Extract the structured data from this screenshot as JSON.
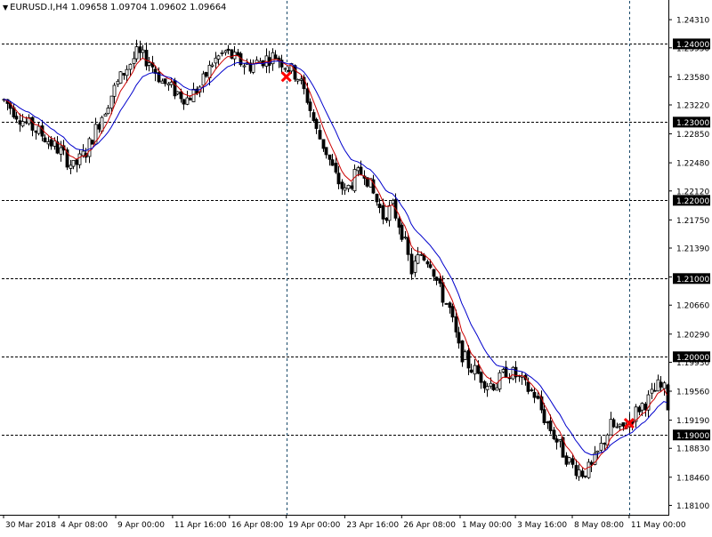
{
  "symbol_header": {
    "arrow_icon": "triangle-down-icon",
    "text": "EURUSD.I,H4  1.09658 1.09704 1.09602 1.09664"
  },
  "chart_data": {
    "type": "candlestick",
    "symbol": "EURUSD.I",
    "timeframe": "H4",
    "ylim": [
      1.1798,
      1.2455
    ],
    "y_ticks": [
      "1.24310",
      "1.23950",
      "1.23580",
      "1.23220",
      "1.22850",
      "1.22480",
      "1.22120",
      "1.21750",
      "1.21390",
      "1.21020",
      "1.20660",
      "1.20290",
      "1.19930",
      "1.19560",
      "1.19190",
      "1.18830",
      "1.18460",
      "1.18100"
    ],
    "x_ticks": [
      "30 Mar 2018",
      "4 Apr 08:00",
      "9 Apr 00:00",
      "11 Apr 16:00",
      "16 Apr 08:00",
      "19 Apr 00:00",
      "23 Apr 16:00",
      "26 Apr 08:00",
      "1 May 00:00",
      "3 May 16:00",
      "8 May 08:00",
      "11 May 00:00"
    ],
    "horizontal_levels": [
      "1.24000",
      "1.23000",
      "1.22000",
      "1.21000",
      "1.20000",
      "1.19000"
    ],
    "vertical_markers": [
      "19 Apr 00:00",
      "11 May 00:00"
    ],
    "signals": [
      {
        "type": "cross",
        "time": "19 Apr 00:00",
        "price": 1.2358
      },
      {
        "type": "cross",
        "time": "11 May 00:00",
        "price": 1.1915
      }
    ],
    "moving_averages": [
      {
        "color": "#cc0000",
        "role": "fast"
      },
      {
        "color": "#0000cc",
        "role": "slow"
      }
    ],
    "close_path": [
      [
        0,
        1.2328
      ],
      [
        6,
        1.2302
      ],
      [
        12,
        1.2284
      ],
      [
        18,
        1.2262
      ],
      [
        22,
        1.2242
      ],
      [
        26,
        1.2262
      ],
      [
        30,
        1.23
      ],
      [
        34,
        1.2335
      ],
      [
        38,
        1.2364
      ],
      [
        42,
        1.2387
      ],
      [
        46,
        1.2378
      ],
      [
        50,
        1.2352
      ],
      [
        54,
        1.234
      ],
      [
        58,
        1.233
      ],
      [
        62,
        1.2345
      ],
      [
        66,
        1.2376
      ],
      [
        70,
        1.239
      ],
      [
        74,
        1.2378
      ],
      [
        78,
        1.2372
      ],
      [
        82,
        1.238
      ],
      [
        86,
        1.2385
      ],
      [
        90,
        1.237
      ],
      [
        93,
        1.2358
      ],
      [
        96,
        1.233
      ],
      [
        99,
        1.2288
      ],
      [
        102,
        1.2262
      ],
      [
        105,
        1.223
      ],
      [
        108,
        1.221
      ],
      [
        111,
        1.223
      ],
      [
        114,
        1.2238
      ],
      [
        117,
        1.2208
      ],
      [
        120,
        1.218
      ],
      [
        123,
        1.2192
      ],
      [
        126,
        1.216
      ],
      [
        129,
        1.211
      ],
      [
        132,
        1.2132
      ],
      [
        135,
        1.2122
      ],
      [
        138,
        1.2085
      ],
      [
        141,
        1.206
      ],
      [
        144,
        1.201
      ],
      [
        147,
        1.199
      ],
      [
        150,
        1.1978
      ],
      [
        153,
        1.1966
      ],
      [
        156,
        1.1965
      ],
      [
        159,
        1.1982
      ],
      [
        162,
        1.1976
      ],
      [
        165,
        1.1962
      ],
      [
        168,
        1.1952
      ],
      [
        171,
        1.1922
      ],
      [
        174,
        1.19
      ],
      [
        177,
        1.1878
      ],
      [
        180,
        1.186
      ],
      [
        183,
        1.1852
      ],
      [
        186,
        1.1858
      ],
      [
        189,
        1.1885
      ],
      [
        192,
        1.1912
      ],
      [
        195,
        1.1905
      ],
      [
        198,
        1.1918
      ],
      [
        201,
        1.1935
      ],
      [
        204,
        1.1945
      ],
      [
        207,
        1.1962
      ],
      [
        210,
        1.1955
      ]
    ],
    "last_close": 1.1932
  }
}
